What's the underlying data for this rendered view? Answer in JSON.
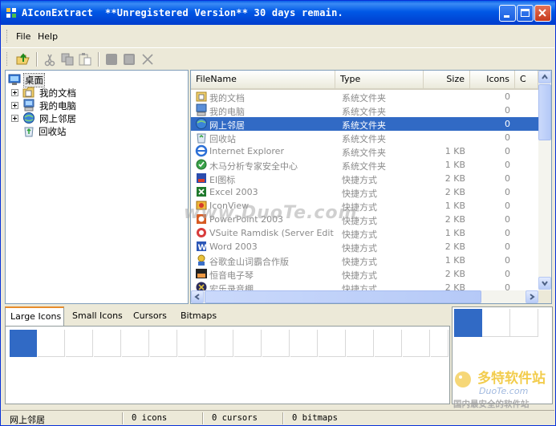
{
  "window": {
    "title": "AIconExtract  **Unregistered Version** 30 days remain.",
    "minimize_glyph": "minimize-icon",
    "maximize_glyph": "maximize-icon",
    "close_glyph": "close-icon"
  },
  "menu": [
    "File",
    "Help"
  ],
  "toolbar": [
    "open-folder-icon",
    "cut-icon",
    "copy-icon",
    "paste-icon",
    "save-icon",
    "save-all-icon",
    "delete-icon"
  ],
  "tree": {
    "root": "桌面",
    "children": [
      "我的文档",
      "我的电脑",
      "网上邻居",
      "回收站"
    ]
  },
  "list": {
    "columns": [
      "FileName",
      "Type",
      "Size",
      "Icons",
      "C"
    ],
    "rows": [
      {
        "name": "我的文档",
        "type": "系统文件夹",
        "size": "",
        "icons": "0"
      },
      {
        "name": "我的电脑",
        "type": "系统文件夹",
        "size": "",
        "icons": "0"
      },
      {
        "name": "网上邻居",
        "type": "系统文件夹",
        "size": "",
        "icons": "0"
      },
      {
        "name": "回收站",
        "type": "系统文件夹",
        "size": "",
        "icons": "0"
      },
      {
        "name": "Internet Explorer",
        "type": "系统文件夹",
        "size": "1 KB",
        "icons": "0"
      },
      {
        "name": "木马分析专家安全中心",
        "type": "系统文件夹",
        "size": "1 KB",
        "icons": "0"
      },
      {
        "name": "EI图标",
        "type": "快捷方式",
        "size": "2 KB",
        "icons": "0"
      },
      {
        "name": "Excel 2003",
        "type": "快捷方式",
        "size": "2 KB",
        "icons": "0"
      },
      {
        "name": "IconView",
        "type": "快捷方式",
        "size": "1 KB",
        "icons": "0"
      },
      {
        "name": "PowerPoint 2003",
        "type": "快捷方式",
        "size": "2 KB",
        "icons": "0"
      },
      {
        "name": "VSuite Ramdisk (Server Edition)",
        "type": "快捷方式",
        "size": "1 KB",
        "icons": "0"
      },
      {
        "name": "Word 2003",
        "type": "快捷方式",
        "size": "2 KB",
        "icons": "0"
      },
      {
        "name": "谷歌金山词霸合作版",
        "type": "快捷方式",
        "size": "1 KB",
        "icons": "0"
      },
      {
        "name": "恒音电子琴",
        "type": "快捷方式",
        "size": "2 KB",
        "icons": "0"
      },
      {
        "name": "宏乐录音棚",
        "type": "快捷方式",
        "size": "2 KB",
        "icons": "0"
      }
    ],
    "selected_index": 2
  },
  "tabs": [
    "Large Icons",
    "Small Icons",
    "Cursors",
    "Bitmaps"
  ],
  "active_tab": 0,
  "status": {
    "location": "网上邻居",
    "icons": "0 icons",
    "cursors": "0 cursors",
    "bitmaps": "0 bitmaps"
  },
  "watermark": "www.DuoTe.com",
  "logo": {
    "line1": "多特软件站",
    "line2": "DuoTe.com",
    "line3": "国内最安全的软件站"
  },
  "colors": {
    "selection": "#316ac5",
    "titlebar": "#0058e6",
    "tab_accent": "#e68b2c"
  }
}
